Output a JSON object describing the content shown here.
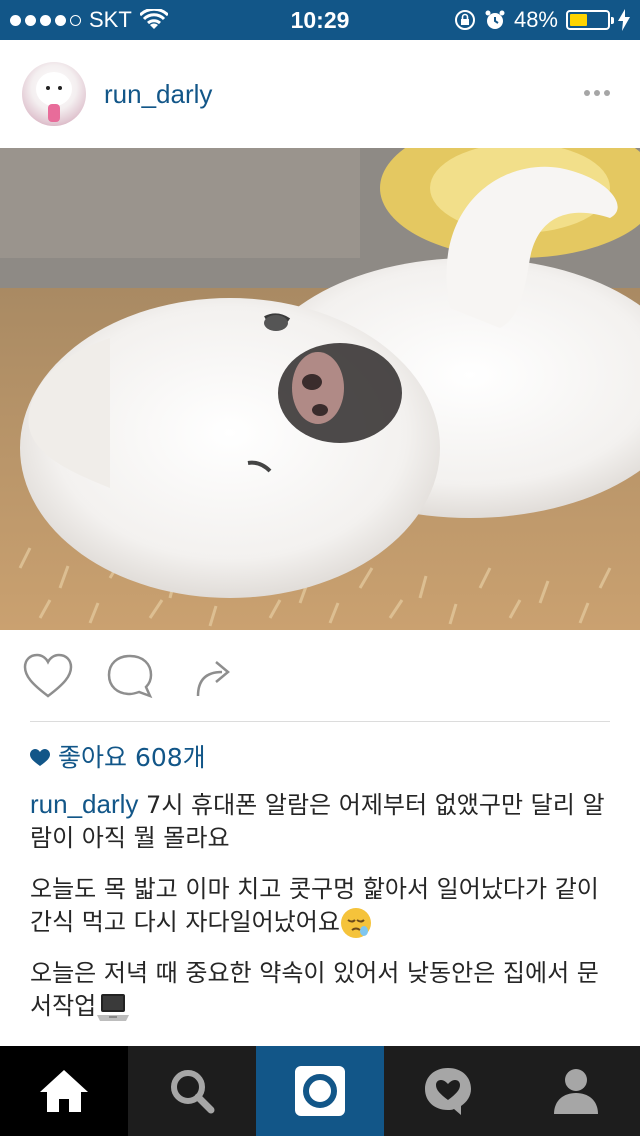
{
  "status_bar": {
    "carrier": "SKT",
    "time": "10:29",
    "battery_pct": "48%",
    "battery_level": 0.48,
    "colors": {
      "bar": "#125688",
      "battery_fill": "#ffd400"
    },
    "icons": [
      "signal-dots-icon",
      "wifi-icon",
      "rotation-lock-icon",
      "alarm-icon",
      "battery-icon",
      "charging-bolt-icon"
    ]
  },
  "post": {
    "username": "run_darly",
    "more_icon": "more-dots-icon",
    "likes_label": "좋아요 608개",
    "caption": {
      "username": "run_darly",
      "paragraphs": [
        "7시 휴대폰 알람은 어제부터 없앴구만 달리 알람이 아직 뭘 몰라요",
        "오늘도 목 밟고 이마 치고 콧구멍 핥아서 일어났다가 같이 간식 먹고 다시 자다일어났어요",
        "오늘은 저녁 때 중요한 약속이 있어서 낮동안은 집에서 문서작업"
      ]
    }
  },
  "actions": {
    "icons": [
      "heart-outline-icon",
      "comment-bubble-icon",
      "share-arrow-icon"
    ]
  },
  "tab_bar": {
    "active_tab": "home",
    "tabs": [
      "home",
      "search",
      "camera",
      "activity",
      "profile"
    ],
    "colors": {
      "bar": "#1d1d1d",
      "active": "#000000",
      "camera": "#125688",
      "icon": "#ffffff",
      "icon_dim": "#a6a6a6"
    }
  },
  "colors": {
    "accent": "#125688",
    "text": "#262626"
  }
}
